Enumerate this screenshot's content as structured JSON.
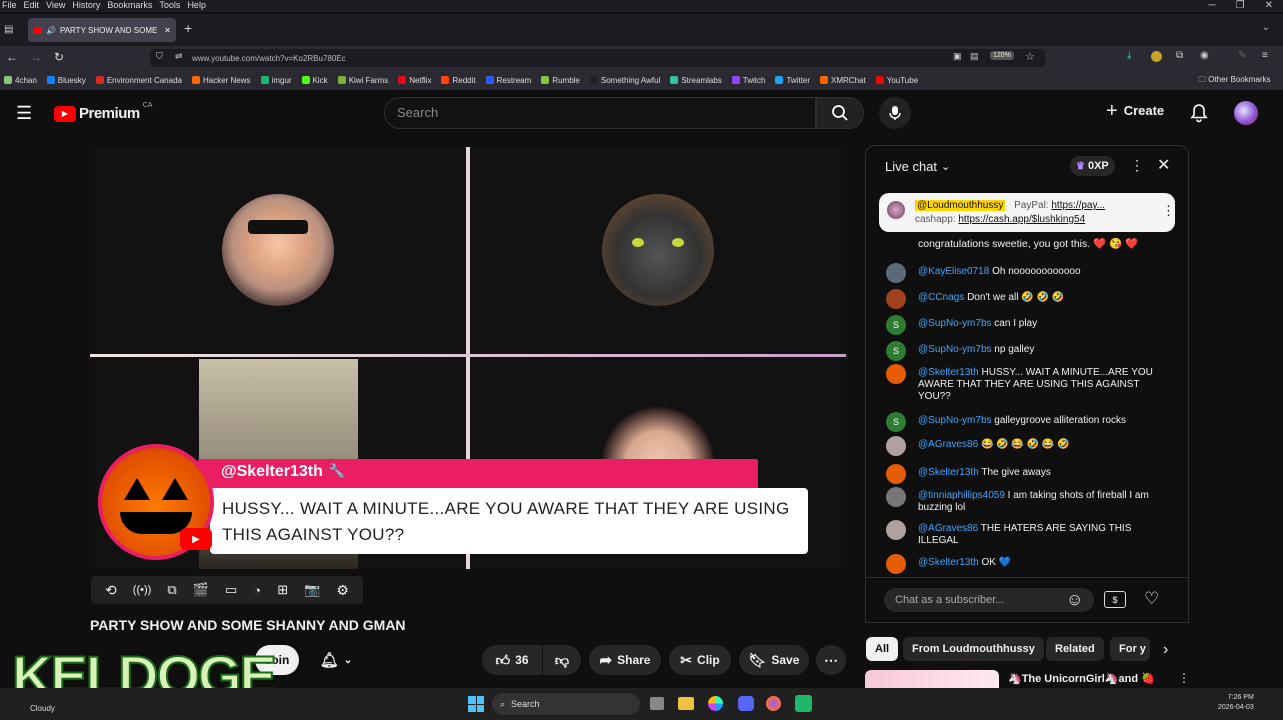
{
  "browser": {
    "menu": [
      "File",
      "Edit",
      "View",
      "History",
      "Bookmarks",
      "Tools",
      "Help"
    ],
    "tab_title": "PARTY SHOW AND SOME S",
    "url": "www.youtube.com/watch?v=Ko2RBu780Ec",
    "zoom": "120%",
    "bookmarks": [
      {
        "label": "4chan",
        "color": "#7fc97f"
      },
      {
        "label": "Bluesky",
        "color": "#1185fe"
      },
      {
        "label": "Environment Canada",
        "color": "#d52b1e"
      },
      {
        "label": "Hacker News",
        "color": "#ff6600"
      },
      {
        "label": "imgur",
        "color": "#1bb76e"
      },
      {
        "label": "Kick",
        "color": "#53fc18"
      },
      {
        "label": "Kiwi Farms",
        "color": "#7bb33a"
      },
      {
        "label": "Netflix",
        "color": "#e50914"
      },
      {
        "label": "Reddit",
        "color": "#ff4500"
      },
      {
        "label": "Restream",
        "color": "#2d5bff"
      },
      {
        "label": "Rumble",
        "color": "#85c742"
      },
      {
        "label": "Something Awful",
        "color": "#222222"
      },
      {
        "label": "Streamlabs",
        "color": "#31c3a2"
      },
      {
        "label": "Twitch",
        "color": "#9146ff"
      },
      {
        "label": "Twitter",
        "color": "#1da1f2"
      },
      {
        "label": "XMRChat",
        "color": "#ff6600"
      },
      {
        "label": "YouTube",
        "color": "#ff0000"
      }
    ],
    "other_bookmarks": "Other Bookmarks"
  },
  "youtube": {
    "logo_text": "Premium",
    "region": "CA",
    "search_placeholder": "Search",
    "create_label": "Create"
  },
  "video": {
    "banner_user": "@Skelter13th",
    "banner_text": "HUSSY... WAIT A MINUTE...ARE YOU AWARE THAT THEY ARE USING THIS AGAINST YOU??",
    "title": "PARTY SHOW AND SOME SHANNY AND GMAN",
    "join_label": "Join",
    "likes": "36",
    "share_label": "Share",
    "clip_label": "Clip",
    "save_label": "Save"
  },
  "chat": {
    "header": "Live chat",
    "xp": "0XP",
    "pinned": {
      "user": "@Loudmouthhussy",
      "text1": "PayPal: ",
      "link1": "https://pay...",
      "text2": "cashapp: ",
      "link2": "https://cash.app/$lushking54"
    },
    "partial_line": "congratulations sweetie, you got this. ❤️ 😘 ❤️",
    "messages": [
      {
        "user": "@KayElise0718",
        "text": "Oh noooooooooooo",
        "color": "#5b6b7a",
        "initial": ""
      },
      {
        "user": "@CCnags",
        "text": "Don't we all 🤣 🤣 🤣",
        "color": "#a0401e",
        "initial": ""
      },
      {
        "user": "@SupNo-ym7bs",
        "text": "can I play",
        "color": "#2e7d32",
        "initial": "S"
      },
      {
        "user": "@SupNo-ym7bs",
        "text": "np galley",
        "color": "#2e7d32",
        "initial": "S"
      },
      {
        "user": "@Skelter13th",
        "text": "HUSSY... WAIT A MINUTE...ARE YOU AWARE THAT THEY ARE USING THIS AGAINST YOU??",
        "color": "#e65c00",
        "initial": ""
      },
      {
        "user": "@SupNo-ym7bs",
        "text": "galleygroove alliteration rocks",
        "color": "#2e7d32",
        "initial": "S"
      },
      {
        "user": "@AGraves86",
        "text": "😂 🤣 😂 🤣 😂 🤣",
        "color": "#b0a0a0",
        "initial": ""
      },
      {
        "user": "@Skelter13th",
        "text": "The give aways",
        "color": "#e65c00",
        "initial": ""
      },
      {
        "user": "@tinniaphillips4059",
        "text": "I am taking shots of fireball I am buzzing lol",
        "color": "#777777",
        "initial": ""
      },
      {
        "user": "@AGraves86",
        "text": "THE HATERS ARE SAYING THIS ILLEGAL",
        "color": "#b0a0a0",
        "initial": ""
      },
      {
        "user": "@Skelter13th",
        "text": "OK 💙",
        "color": "#e65c00",
        "initial": ""
      }
    ],
    "input_placeholder": "Chat as a subscriber..."
  },
  "chips": [
    "All",
    "From Loudmouthhussy",
    "Related",
    "For y"
  ],
  "rec_title": "🦄The UnicornGirl🦄and 🍓",
  "overlay_text": "KELDOGE",
  "taskbar": {
    "weather": "Cloudy",
    "search": "Search",
    "time": "7:26 PM",
    "date": "2026-04-03"
  }
}
